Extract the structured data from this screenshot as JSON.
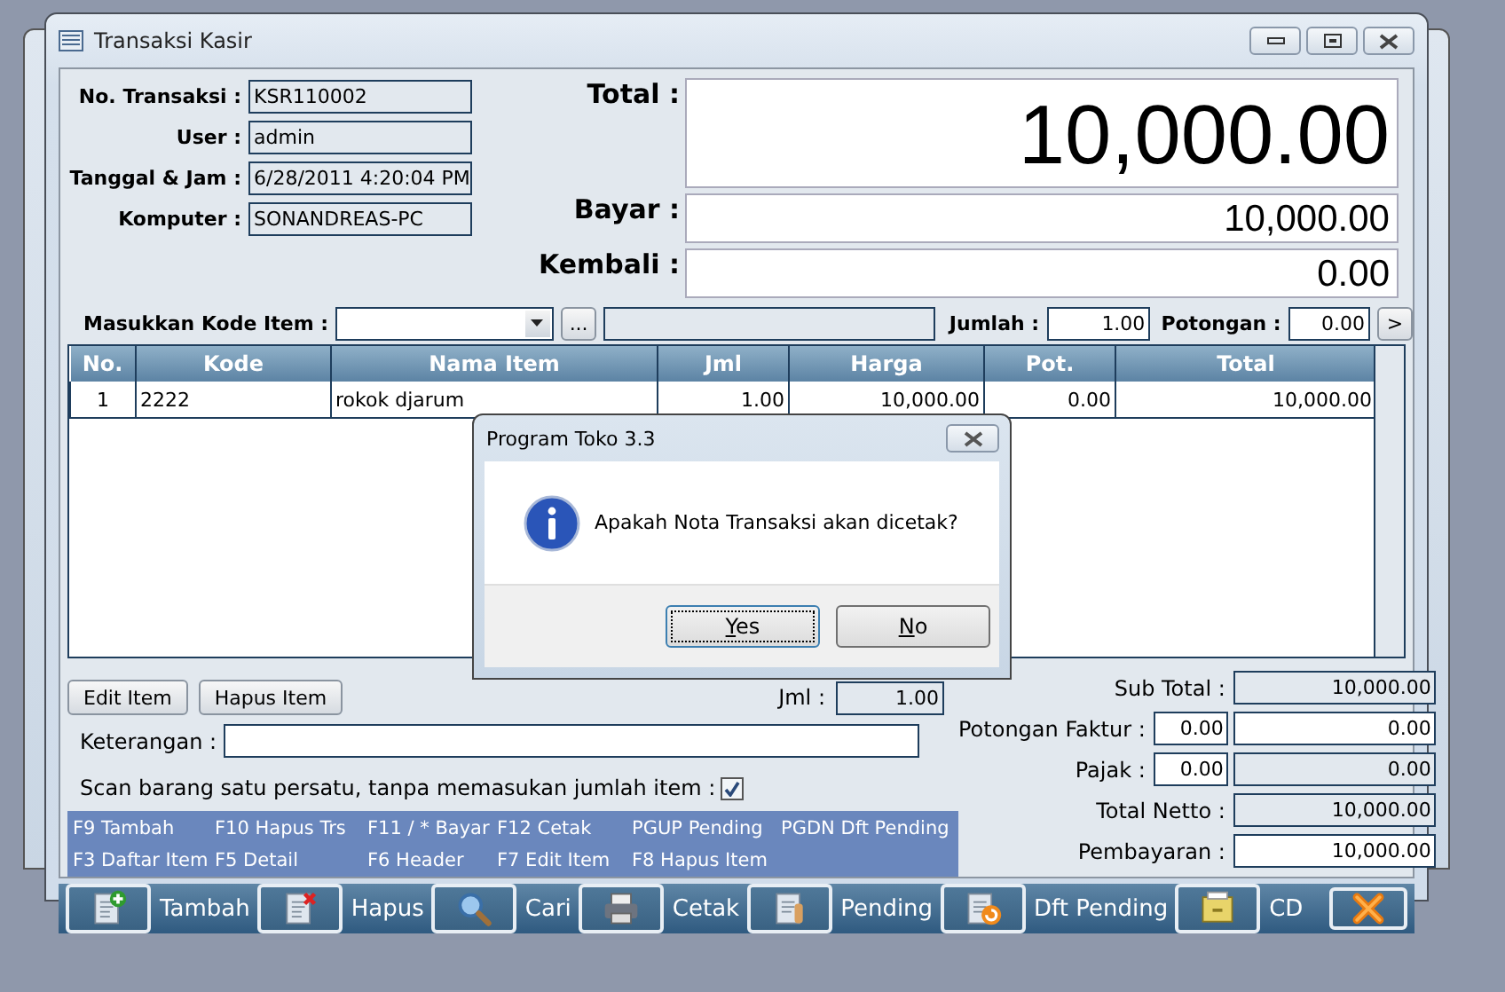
{
  "window": {
    "title": "Transaksi Kasir"
  },
  "header_fields": [
    {
      "label": "No. Transaksi :",
      "value": "KSR110002"
    },
    {
      "label": "User :",
      "value": "admin"
    },
    {
      "label": "Tanggal & Jam :",
      "value": "6/28/2011 4:20:04 PM"
    },
    {
      "label": "Komputer :",
      "value": "SONANDREAS-PC"
    }
  ],
  "totals": [
    {
      "label": "Total :",
      "value": "10,000.00",
      "kind": "large"
    },
    {
      "label": "Bayar :",
      "value": "10,000.00",
      "kind": "medium"
    },
    {
      "label": "Kembali :",
      "value": "0.00",
      "kind": "medium"
    }
  ],
  "item_entry": {
    "label": "Masukkan Kode Item :",
    "browse_button": "...",
    "jumlah_label": "Jumlah :",
    "jumlah": "1.00",
    "potongan_label": "Potongan :",
    "potongan": "0.00",
    "add_button": ">"
  },
  "table": {
    "columns": [
      "No.",
      "Kode",
      "Nama Item",
      "Jml",
      "Harga",
      "Pot.",
      "Total"
    ],
    "rows": [
      [
        "1",
        "2222",
        "rokok djarum",
        "1.00",
        "10,000.00",
        "0.00",
        "10,000.00"
      ]
    ]
  },
  "edit_buttons": [
    "Edit Item",
    "Hapus Item"
  ],
  "jml": {
    "label": "Jml :",
    "value": "1.00"
  },
  "keterangan": {
    "label": "Keterangan :"
  },
  "scan_option": {
    "label": "Scan barang satu persatu, tanpa memasukan jumlah item :",
    "checked": true
  },
  "shortcuts": [
    [
      "F9 Tambah",
      "F10 Hapus Trs",
      "F11 / * Bayar",
      "F12 Cetak",
      "PGUP Pending",
      "PGDN Dft Pending"
    ],
    [
      "F3 Daftar Item",
      "F5 Detail",
      "F6 Header",
      "F7 Edit Item",
      "F8 Hapus Item"
    ]
  ],
  "summary": [
    {
      "label": "Sub Total :",
      "fields": [
        {
          "value": "10,000.00",
          "editable": false
        }
      ]
    },
    {
      "label": "Potongan Faktur :",
      "fields": [
        {
          "value": "0.00",
          "editable": true
        },
        {
          "value": "0.00",
          "editable": true
        }
      ]
    },
    {
      "label": "Pajak :",
      "fields": [
        {
          "value": "0.00",
          "editable": true
        },
        {
          "value": "0.00",
          "editable": false
        }
      ]
    },
    {
      "label": "Total Netto :",
      "fields": [
        {
          "value": "10,000.00",
          "editable": false
        }
      ]
    },
    {
      "label": "Pembayaran :",
      "fields": [
        {
          "value": "10,000.00",
          "editable": true
        }
      ]
    }
  ],
  "toolbar": [
    {
      "kind": "add",
      "label": "Tambah"
    },
    {
      "kind": "delete",
      "label": "Hapus"
    },
    {
      "kind": "search",
      "label": "Cari"
    },
    {
      "kind": "print",
      "label": "Cetak"
    },
    {
      "kind": "pending",
      "label": "Pending"
    },
    {
      "kind": "pending-list",
      "label": "Dft Pending"
    },
    {
      "kind": "drawer",
      "label": "CD"
    },
    {
      "kind": "close"
    }
  ],
  "dialog": {
    "title": "Program Toko 3.3",
    "message": "Apakah Nota Transaksi akan dicetak?",
    "buttons": [
      {
        "label": "Yes",
        "selected": true
      },
      {
        "label": "No",
        "selected": false
      }
    ]
  }
}
